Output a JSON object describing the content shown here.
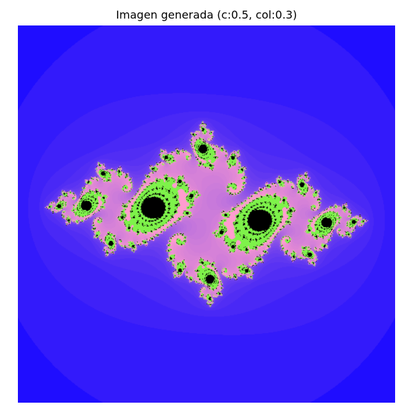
{
  "figure": {
    "title": "Imagen generada (c:0.5, col:0.3)"
  },
  "render": {
    "fractal_type": "julia",
    "c_real": -0.75,
    "c_imag": 0.12,
    "max_iter": 120,
    "colors": {
      "background": "#1f0dff",
      "halo": "#ff9ccf",
      "edge": "#7ef24a",
      "interior": "#000000"
    }
  }
}
